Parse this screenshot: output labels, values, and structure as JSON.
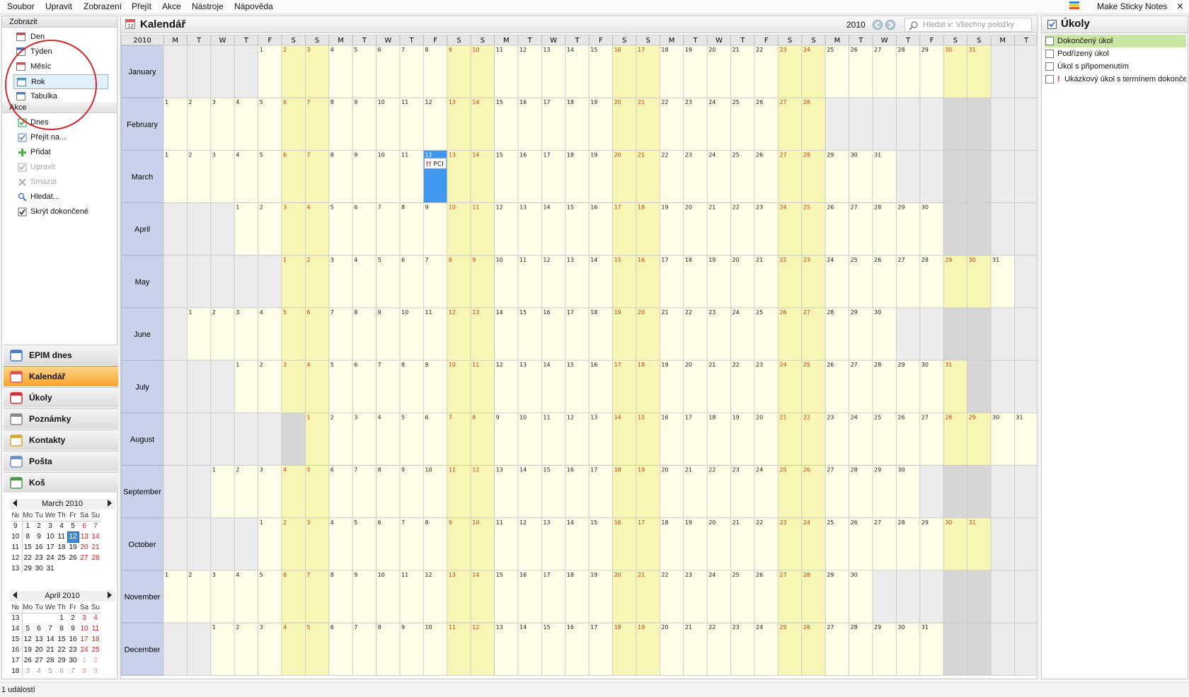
{
  "menu": [
    "Soubor",
    "Upravit",
    "Zobrazení",
    "Přejít",
    "Akce",
    "Nástroje",
    "Nápověda"
  ],
  "sticky_notes": "Make Sticky Notes",
  "close_glyph": "×",
  "sidebar": {
    "views_header": "Zobrazit",
    "views": [
      {
        "label": "Den",
        "icon": "day-view-icon"
      },
      {
        "label": "Týden",
        "icon": "week-view-icon"
      },
      {
        "label": "Měsíc",
        "icon": "month-view-icon"
      },
      {
        "label": "Rok",
        "icon": "year-view-icon",
        "selected": true
      },
      {
        "label": "Tabulka",
        "icon": "table-view-icon"
      }
    ],
    "actions_header": "Akce",
    "actions": [
      {
        "label": "Dnes",
        "icon": "today-icon",
        "enabled": true
      },
      {
        "label": "Přejít na...",
        "icon": "goto-icon",
        "enabled": true
      },
      {
        "label": "Přidat",
        "icon": "add-icon",
        "enabled": true
      },
      {
        "label": "Upravit",
        "icon": "edit-icon",
        "enabled": false
      },
      {
        "label": "Smazat",
        "icon": "delete-icon",
        "enabled": false
      },
      {
        "label": "Hledat...",
        "icon": "search-icon",
        "enabled": true
      },
      {
        "label": "Skrýt dokončené",
        "icon": "checkbox-checked-icon",
        "enabled": true
      }
    ]
  },
  "nav": [
    {
      "label": "EPIM dnes",
      "icon": "epim-today-icon",
      "active": false
    },
    {
      "label": "Kalendář",
      "icon": "calendar-icon",
      "active": true
    },
    {
      "label": "Úkoly",
      "icon": "tasks-icon",
      "active": false
    },
    {
      "label": "Poznámky",
      "icon": "notes-icon",
      "active": false
    },
    {
      "label": "Kontakty",
      "icon": "contacts-icon",
      "active": false
    },
    {
      "label": "Pošta",
      "icon": "mail-icon",
      "active": false
    },
    {
      "label": "Koš",
      "icon": "trash-icon",
      "active": false
    }
  ],
  "mini_calendars": [
    {
      "month_label": "March",
      "year": "2010",
      "headers": [
        "№",
        "Mo",
        "Tu",
        "We",
        "Th",
        "Fr",
        "Sa",
        "Su"
      ],
      "rows": [
        [
          "9",
          "1",
          "2",
          "3",
          "4",
          "5",
          "6",
          "7"
        ],
        [
          "10",
          "8",
          "9",
          "10",
          "11",
          "12",
          "13",
          "14"
        ],
        [
          "11",
          "15",
          "16",
          "17",
          "18",
          "19",
          "20",
          "21"
        ],
        [
          "12",
          "22",
          "23",
          "24",
          "25",
          "26",
          "27",
          "28"
        ],
        [
          "13",
          "29",
          "30",
          "31",
          "",
          "",
          "",
          ""
        ]
      ],
      "today": [
        1,
        5
      ],
      "other": []
    },
    {
      "month_label": "April",
      "year": "2010",
      "headers": [
        "№",
        "Mo",
        "Tu",
        "We",
        "Th",
        "Fr",
        "Sa",
        "Su"
      ],
      "rows": [
        [
          "13",
          "",
          "",
          "",
          "1",
          "2",
          "3",
          "4"
        ],
        [
          "14",
          "5",
          "6",
          "7",
          "8",
          "9",
          "10",
          "11"
        ],
        [
          "15",
          "12",
          "13",
          "14",
          "15",
          "16",
          "17",
          "18"
        ],
        [
          "16",
          "19",
          "20",
          "21",
          "22",
          "23",
          "24",
          "25"
        ],
        [
          "17",
          "26",
          "27",
          "28",
          "29",
          "30",
          "1",
          "2"
        ],
        [
          "18",
          "3",
          "4",
          "5",
          "6",
          "7",
          "8",
          "9"
        ]
      ],
      "today": null,
      "other": [
        [
          4,
          6
        ],
        [
          4,
          7
        ],
        [
          5,
          1
        ],
        [
          5,
          2
        ],
        [
          5,
          3
        ],
        [
          5,
          4
        ],
        [
          5,
          5
        ],
        [
          5,
          6
        ],
        [
          5,
          7
        ]
      ]
    }
  ],
  "calendar": {
    "title": "Kalendář",
    "year": "2010",
    "search_placeholder": "Hledat v: Všechny položky",
    "weekday_letters": [
      "M",
      "T",
      "W",
      "T",
      "F",
      "S",
      "S"
    ],
    "months": [
      "January",
      "February",
      "March",
      "April",
      "May",
      "June",
      "July",
      "August",
      "September",
      "October",
      "November",
      "December"
    ],
    "month_start_col": [
      4,
      0,
      0,
      3,
      5,
      1,
      3,
      6,
      2,
      4,
      0,
      2
    ],
    "month_days": [
      31,
      28,
      31,
      30,
      31,
      30,
      31,
      31,
      30,
      31,
      30,
      31
    ],
    "today": {
      "month": 2,
      "day": 12
    },
    "event": {
      "month": 2,
      "day": 12,
      "label": "PCI",
      "marker": "!!"
    }
  },
  "tasks": {
    "title": "Úkoly",
    "items": [
      {
        "label": "Dokončený úkol",
        "done": true,
        "priority": false
      },
      {
        "label": "Podřízený úkol",
        "done": false,
        "priority": false
      },
      {
        "label": "Úkol s připomenutím",
        "done": false,
        "priority": false
      },
      {
        "label": "Ukázkový úkol s termínem dokončení",
        "done": false,
        "priority": true,
        "priority_mark": "!"
      }
    ]
  },
  "status": "1 událostí",
  "colors": {
    "weekend": "#f8f6b4",
    "weekday": "#fdfde8",
    "outside": "#ececec",
    "outside_weekend": "#d6d6d6",
    "month_cell": "#c9d2ea",
    "today": "#3f98ee",
    "weekend_num": "#c83b18",
    "active_nav": "#f8a32a"
  }
}
